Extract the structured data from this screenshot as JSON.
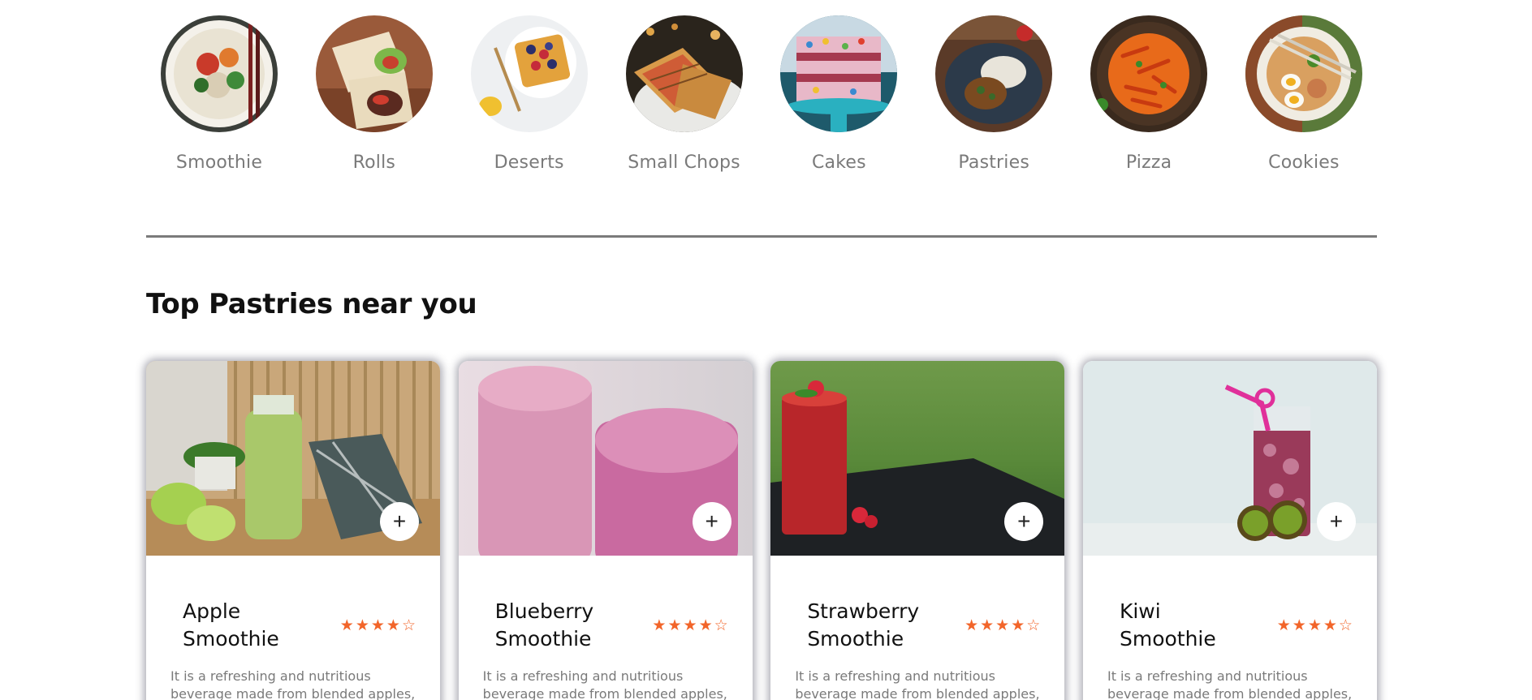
{
  "categories": [
    {
      "label": "Smoothie",
      "icon": "ramen-bowl-image"
    },
    {
      "label": "Rolls",
      "icon": "wrap-rolls-image"
    },
    {
      "label": "Deserts",
      "icon": "waffle-image"
    },
    {
      "label": "Small Chops",
      "icon": "sandwich-image"
    },
    {
      "label": "Cakes",
      "icon": "cake-image"
    },
    {
      "label": "Pastries",
      "icon": "rice-plate-image"
    },
    {
      "label": "Pizza",
      "icon": "pasta-image"
    },
    {
      "label": "Cookies",
      "icon": "noodle-bowl-image"
    }
  ],
  "section": {
    "title": "Top Pastries near you"
  },
  "cards": [
    {
      "title": "Apple Smoothie",
      "rating": 4,
      "rating_max": 5,
      "description": "It is a refreshing and nutritious beverage made from blended apples,",
      "add_label": "+"
    },
    {
      "title": "Blueberry Smoothie",
      "rating": 4,
      "rating_max": 5,
      "description": "It is a refreshing and nutritious beverage made from blended apples,",
      "add_label": "+"
    },
    {
      "title": "Strawberry Smoothie",
      "rating": 4,
      "rating_max": 5,
      "description": "It is a refreshing and nutritious beverage made from blended apples,",
      "add_label": "+"
    },
    {
      "title": "Kiwi Smoothie",
      "rating": 4,
      "rating_max": 5,
      "description": "It is a refreshing and nutritious beverage made from blended apples,",
      "add_label": "+"
    }
  ],
  "colors": {
    "star": "#f2652a",
    "divider": "#7b7b7b",
    "muted_text": "#7a7a7a"
  }
}
